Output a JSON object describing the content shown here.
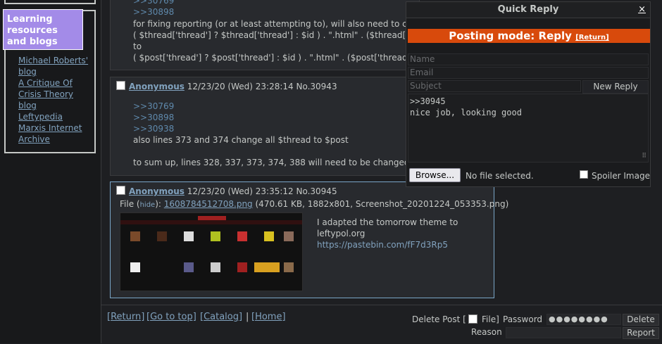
{
  "sidebar": {
    "heading": "Learning resources and blogs",
    "links": [
      "Michael Roberts' blog",
      "A Critique Of Crisis Theory blog",
      "Leftypedia",
      "Marxis Internet Archive"
    ]
  },
  "post1": {
    "quotes": [
      ">>30769",
      ">>30898"
    ],
    "lines": [
      "for fixing reporting (or at least attempting to), will also need to chang",
      "( $thread['thread'] ? $thread['thread'] : $id ) . \".html\"  .  ($thread['thre",
      "to",
      "( $post['thread'] ? $post['thread'] : $id ) . \".html\"  .  ($post['thread']"
    ]
  },
  "post2": {
    "name": "Anonymous",
    "date": "12/23/20 (Wed) 23:28:14",
    "no": "No.30943",
    "quotes": [
      ">>30769",
      ">>30898",
      ">>30938"
    ],
    "line1": "also lines 373 and 374 change all $thread to $post",
    "line2": "to sum up, lines 328, 337, 373, 374, 388 will need to be changed"
  },
  "post3": {
    "name": "Anonymous",
    "date": "12/23/20 (Wed) 23:35:12",
    "no": "No.30945",
    "file_label": "File",
    "hide": "hide",
    "filename": "1608784512708.png",
    "fileinfo": "(470.61 KB, 1882x801, Screenshot_20201224_053353.png)",
    "text1": "I adapted the tomorrow theme to",
    "text2": "leftypol.org",
    "link": "https://pastebin.com/fF7d3Rp5"
  },
  "quick_reply": {
    "title": "Quick Reply",
    "close": "×",
    "mode": "Posting mode: Reply",
    "return": "[Return]",
    "name_placeholder": "Name",
    "email_placeholder": "Email",
    "subject_placeholder": "Subject",
    "new_reply": "New Reply",
    "message_line1": ">>30945",
    "message_line2": "nice job, looking good",
    "browse": "Browse...",
    "no_file": "No file selected.",
    "spoiler": "Spoiler Image"
  },
  "bottom": {
    "return": "[Return]",
    "top": "[Go to top]",
    "catalog": "[Catalog]",
    "sep": "|",
    "home": "[Home]",
    "delete_post": "Delete Post [",
    "file": "File]",
    "password": "Password",
    "password_value": "●●●●●●●●",
    "delete": "Delete",
    "reason": "Reason",
    "report": "Report"
  },
  "colors": {
    "accent": "#81a2be",
    "mode_bar": "#d84a0c",
    "heading_bg": "#a38be8"
  }
}
